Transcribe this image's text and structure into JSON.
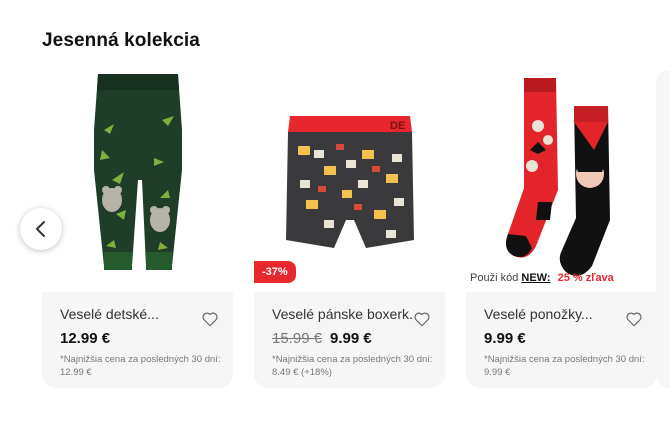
{
  "section": {
    "title": "Jesenná kolekcia"
  },
  "colors": {
    "accent": "#e8262d",
    "card_bg": "#f6f6f6"
  },
  "carousel": {
    "prev_icon": "chevron-left-icon",
    "products": [
      {
        "name": "Veselé detské...",
        "price": "12.99 €",
        "old_price": "",
        "lowest_note": "*Najnižšia cena za posledných 30 dní: 12.99 €",
        "badge": "",
        "image": "kids-tights-koala"
      },
      {
        "name": "Veselé pánske boxerk...",
        "price": "9.99 €",
        "old_price": "15.99 €",
        "lowest_note": "*Najnižšia cena za posledných 30 dní: 8.49 € (+18%)",
        "badge": "-37%",
        "image": "boxer-shorts-books"
      },
      {
        "name": "Veselé ponožky...",
        "price": "9.99 €",
        "old_price": "",
        "lowest_note": "*Najnižšia cena za posledných 30 dní: 9.99 €",
        "badge": "",
        "image": "socks-vampire",
        "promo": {
          "prefix": "Použi kód",
          "code": "NEW:",
          "discount": "25 % zľava"
        }
      }
    ]
  }
}
